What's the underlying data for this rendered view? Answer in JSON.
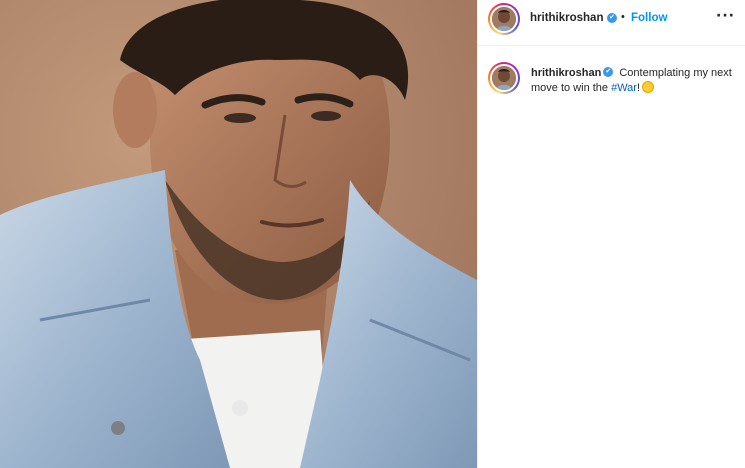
{
  "post": {
    "photo_alt": "",
    "header": {
      "username": "hrithikroshan",
      "dot": "•",
      "follow_label": "Follow",
      "more_label": "···",
      "verified_mark": "✔"
    },
    "caption": {
      "username": "hrithikroshan",
      "text_before": " Contemplating my next move to win the ",
      "hashtag": "#War",
      "text_after": "!",
      "emoji": "smirking-face-emoji"
    }
  },
  "colors": {
    "follow": "#0095f6",
    "verified": "#3897f0",
    "hashtag": "#0064c8",
    "photo_background": "#b58d72",
    "denim": "#a9bfd6"
  }
}
